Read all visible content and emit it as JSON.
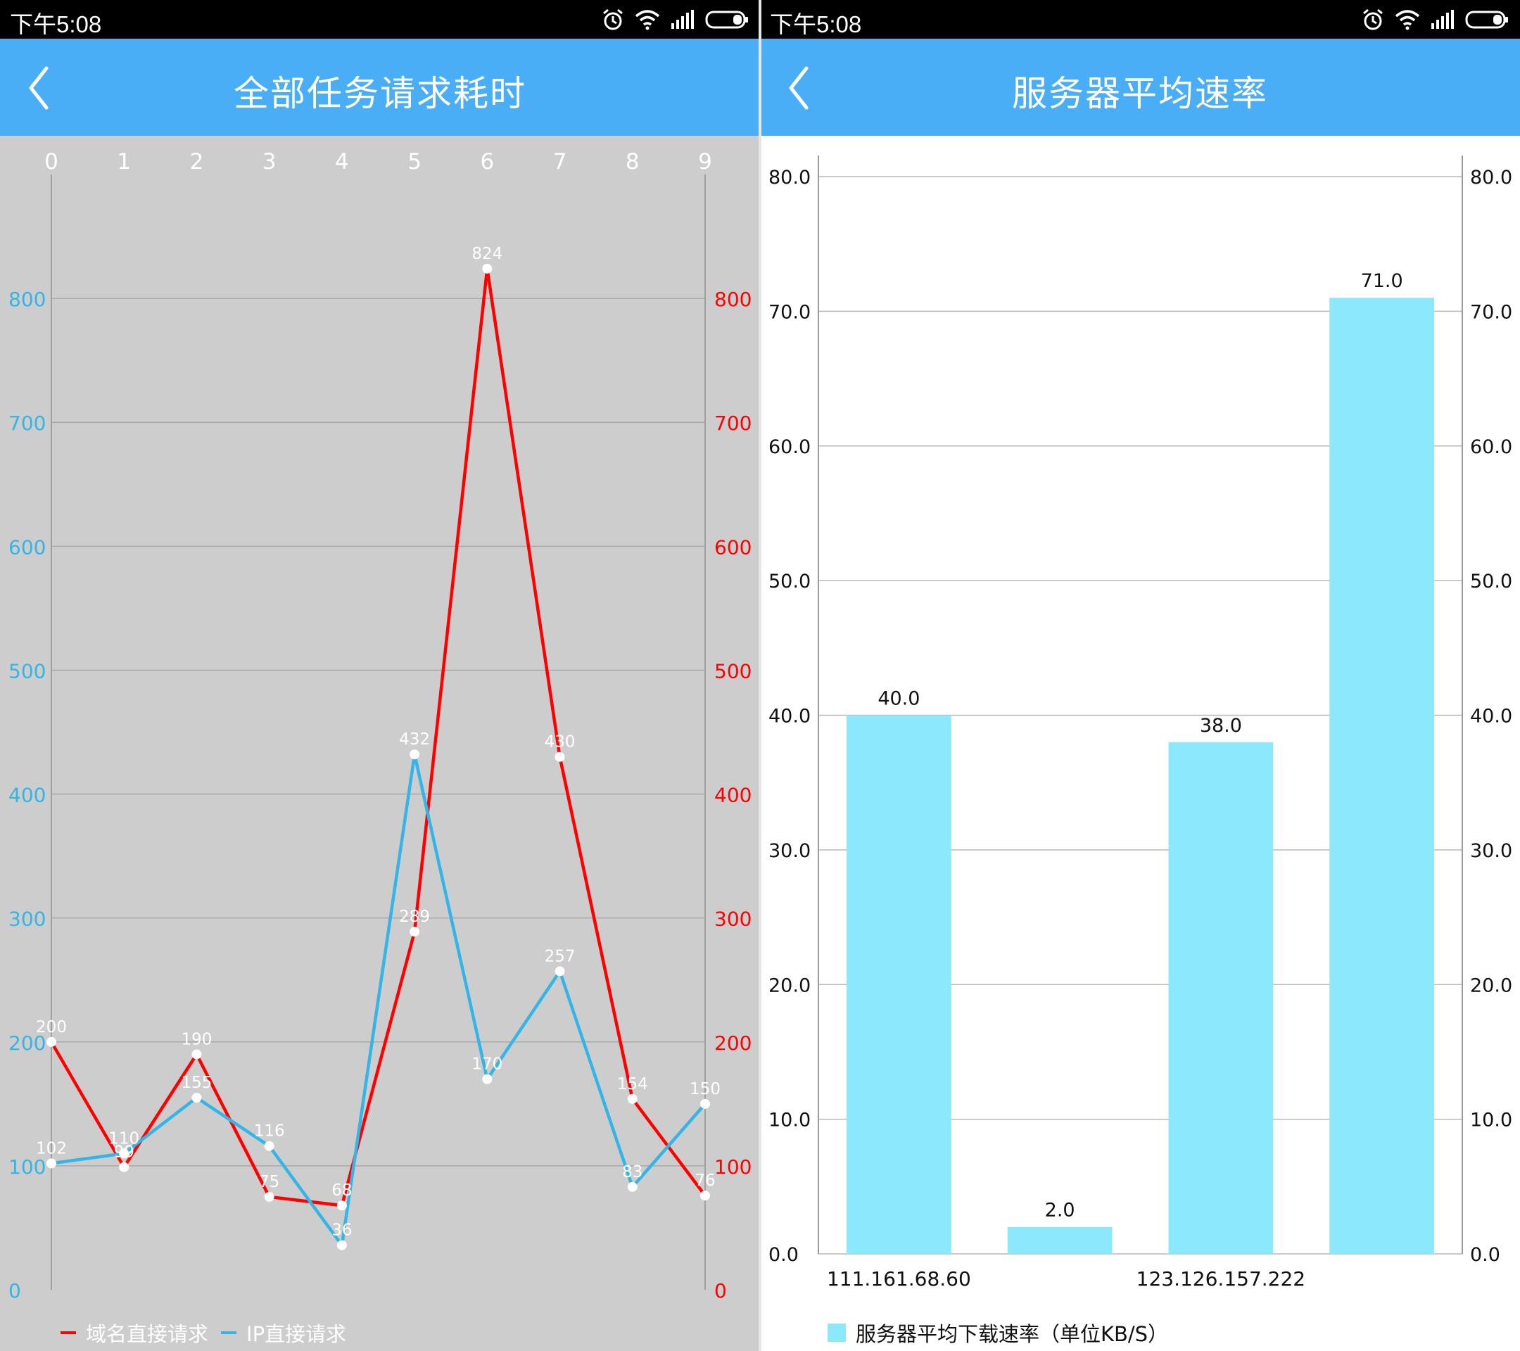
{
  "status_bar": {
    "time": "下午5:08"
  },
  "left": {
    "title": "全部任务请求耗时",
    "legend": [
      {
        "label": "域名直接请求",
        "color": "#ff0000"
      },
      {
        "label": "IP直接请求",
        "color": "#33b5e5"
      }
    ]
  },
  "right": {
    "title": "服务器平均速率",
    "legend": [
      {
        "label": "服务器平均下载速率（单位KB/S）",
        "color": "#8ce9fd"
      }
    ]
  },
  "chart_data": [
    {
      "type": "line",
      "x": [
        0,
        1,
        2,
        3,
        4,
        5,
        6,
        7,
        8,
        9
      ],
      "xlim": [
        0,
        9
      ],
      "ylim": [
        0,
        900
      ],
      "yticks": [
        0,
        100,
        200,
        300,
        400,
        500,
        600,
        700,
        800
      ],
      "left_axis_color": "#33b5e5",
      "right_axis_color": "#ff0000",
      "grid": true,
      "legend_position": "bottom-left",
      "series": [
        {
          "name": "域名直接请求",
          "color": "#ff0000",
          "values": [
            200,
            99,
            190,
            75,
            68,
            289,
            824,
            430,
            154,
            76
          ]
        },
        {
          "name": "IP直接请求",
          "color": "#33b5e5",
          "values": [
            102,
            110,
            155,
            116,
            36,
            432,
            170,
            257,
            83,
            150
          ]
        }
      ]
    },
    {
      "type": "bar",
      "categories": [
        "111.161.68.60",
        "",
        "123.126.157.222",
        ""
      ],
      "values": [
        40.0,
        2.0,
        38.0,
        71.0
      ],
      "ylim": [
        0,
        80
      ],
      "yticks": [
        0.0,
        10.0,
        20.0,
        30.0,
        40.0,
        50.0,
        60.0,
        70.0,
        80.0
      ],
      "bar_color": "#8ce9fd",
      "grid": true,
      "legend_position": "bottom-left",
      "series": [
        {
          "name": "服务器平均下载速率（单位KB/S）",
          "values": [
            40.0,
            2.0,
            38.0,
            71.0
          ]
        }
      ]
    }
  ]
}
